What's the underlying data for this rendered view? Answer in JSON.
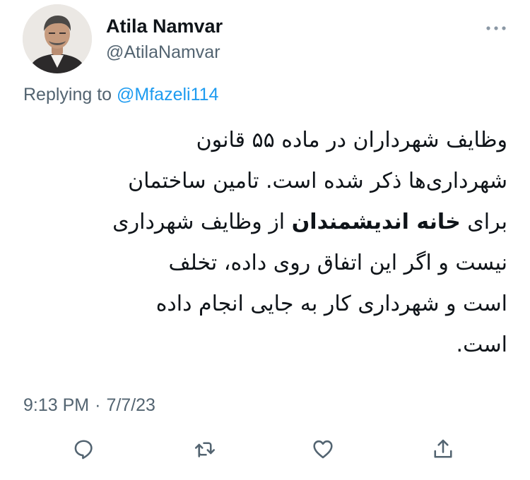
{
  "author": {
    "name": "Atila Namvar",
    "handle": "@AtilaNamvar"
  },
  "reply": {
    "prefix": "Replying to ",
    "mention": "@Mfazeli114"
  },
  "tweet": {
    "line1": "وظایف شهرداران در ماده ۵۵ قانون",
    "line2": "شهرداری‌ها ذکر شده است. تامین  ساختمان",
    "line3_before": "برای ",
    "line3_bold": "خانه اندیشمندان",
    "line3_after": " از وظایف شهرداری",
    "line4": "نیست و اگر این اتفاق روی داده، تخلف",
    "line5": "است و شهرداری کار به جایی انجام داده",
    "line6": "است."
  },
  "meta": {
    "time": "9:13 PM",
    "separator": "·",
    "date": "7/7/23"
  },
  "actions": [
    "reply-icon",
    "retweet-icon",
    "like-icon",
    "share-icon"
  ],
  "colors": {
    "text": "#0f1419",
    "secondary": "#536471",
    "link": "#1d9bf0"
  }
}
